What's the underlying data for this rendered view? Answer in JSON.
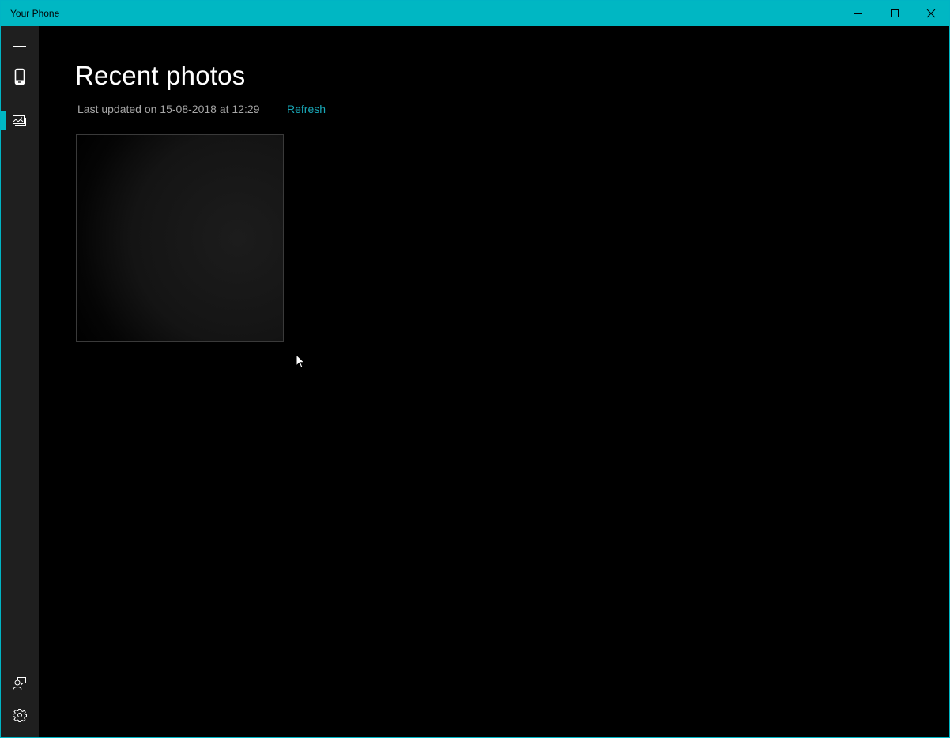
{
  "window": {
    "title": "Your Phone",
    "controls": {
      "minimize": "minimize-icon",
      "maximize": "maximize-icon",
      "close": "close-icon"
    },
    "accent_color": "#00b7c3"
  },
  "sidebar": {
    "top_items": [
      {
        "name": "menu",
        "icon": "hamburger-icon",
        "selected": false
      },
      {
        "name": "phone",
        "icon": "phone-icon",
        "selected": false
      },
      {
        "name": "photos",
        "icon": "photos-icon",
        "selected": true
      }
    ],
    "bottom_items": [
      {
        "name": "feedback",
        "icon": "feedback-icon"
      },
      {
        "name": "settings",
        "icon": "gear-icon"
      }
    ]
  },
  "main": {
    "title": "Recent photos",
    "last_updated": "Last updated on 15-08-2018 at 12:29",
    "refresh_label": "Refresh",
    "photos_count": 1
  }
}
